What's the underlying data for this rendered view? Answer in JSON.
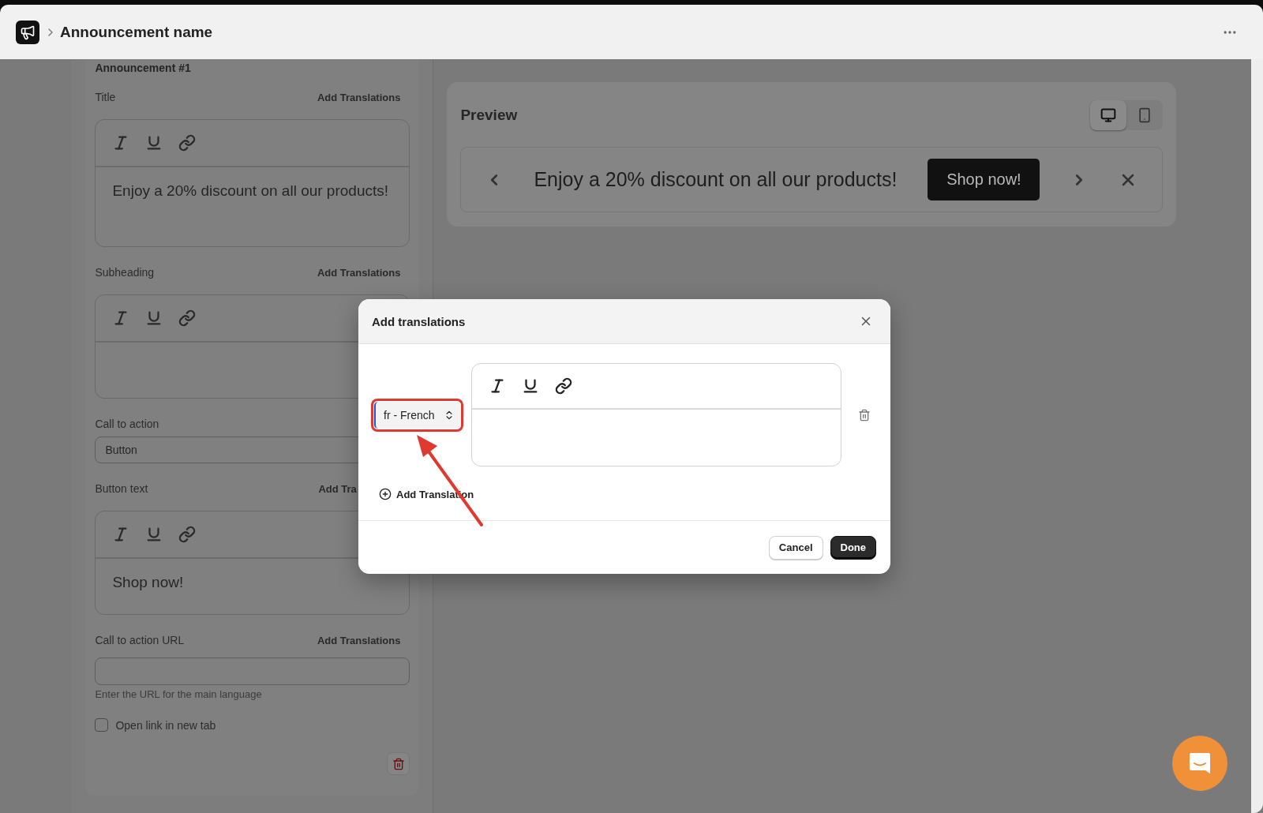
{
  "header": {
    "title": "Announcement name"
  },
  "form": {
    "section_title": "Announcement #1",
    "fields": [
      {
        "kind": "rich",
        "label": "Title",
        "action": "Add Translations",
        "value": "Enjoy a 20% discount on all our products!"
      },
      {
        "kind": "rich",
        "label": "Subheading",
        "action": "Add Translations"
      },
      {
        "kind": "select",
        "label": "Call to action",
        "value": "Button"
      },
      {
        "kind": "rich",
        "label": "Button text",
        "action": "Add Tra",
        "value": "Shop now!"
      },
      {
        "kind": "text",
        "label": "Call to action URL",
        "action": "Add Translations",
        "help": "Enter the URL for the main language"
      },
      {
        "kind": "checkbox",
        "label": "Open link in new tab",
        "checked": false
      }
    ]
  },
  "preview": {
    "title": "Preview",
    "devices": [
      {
        "kind": "desktop",
        "selected": true
      },
      {
        "kind": "mobile",
        "selected": false
      }
    ],
    "banner": {
      "text": "Enjoy a 20% discount on all our products!",
      "button": "Shop now!"
    }
  },
  "dialog": {
    "title": "Add translations",
    "rows": [
      {
        "language": "fr - French",
        "highlighted": true
      }
    ],
    "add_label": "Add Translation",
    "buttons": [
      {
        "label": "Cancel",
        "kind": "secondary"
      },
      {
        "label": "Done",
        "kind": "primary"
      }
    ]
  }
}
